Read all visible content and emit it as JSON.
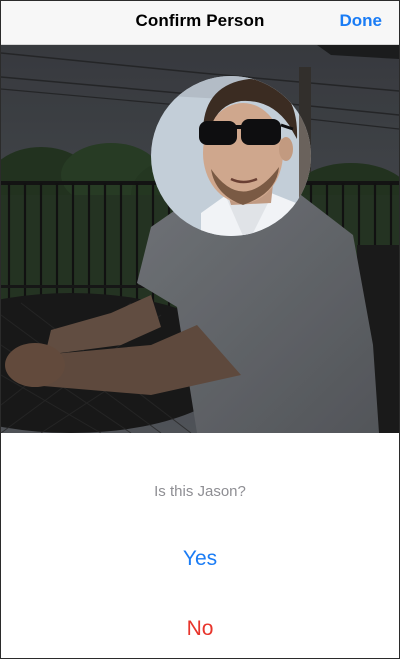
{
  "navbar": {
    "title": "Confirm Person",
    "done_label": "Done"
  },
  "photo": {
    "subject": "man-with-sunglasses-on-patio",
    "face_highlight": "circle-spotlight"
  },
  "prompt": {
    "question": "Is this Jason?",
    "yes_label": "Yes",
    "no_label": "No"
  },
  "colors": {
    "accent": "#1a7cf5",
    "destructive": "#e8352c",
    "secondary_text": "#8e8e93",
    "navbar_bg": "#f7f7f7"
  }
}
